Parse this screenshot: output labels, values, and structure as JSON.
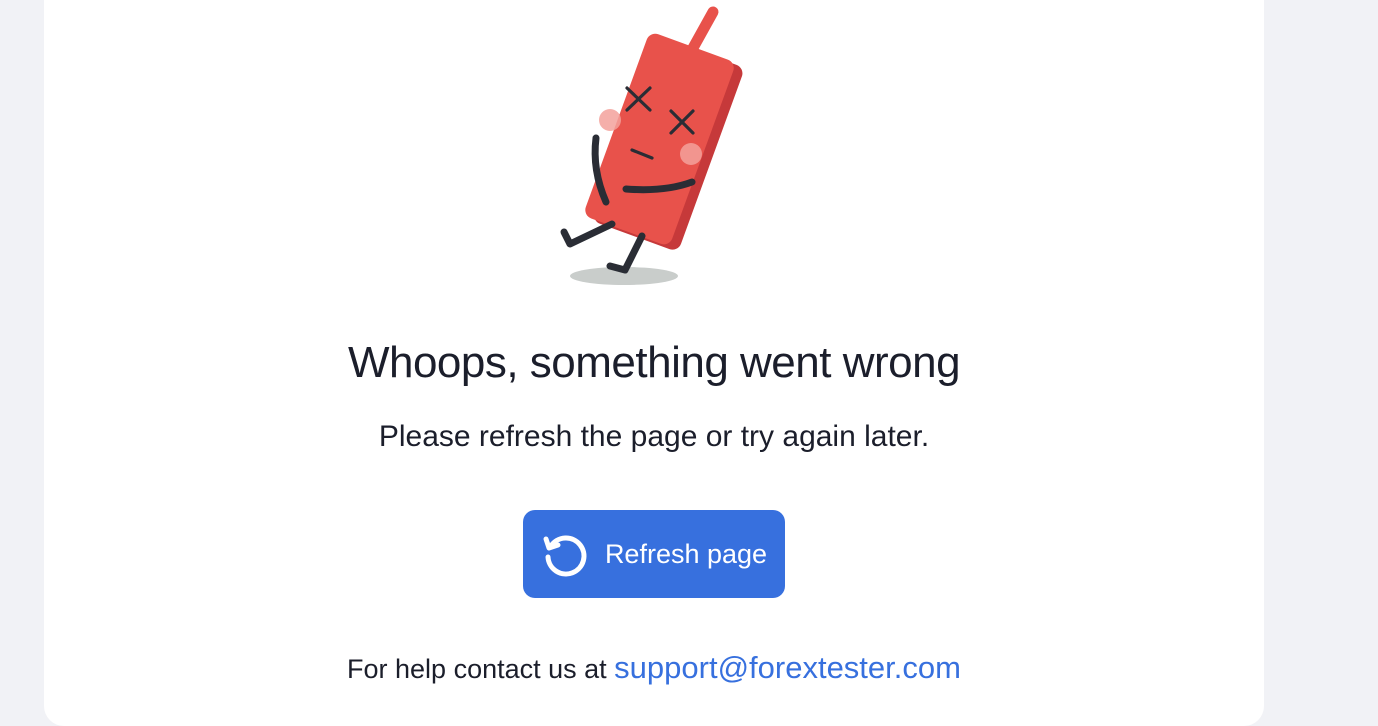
{
  "error": {
    "title": "Whoops, something went wrong",
    "message": "Please refresh the page or try again later.",
    "refresh_button_label": "Refresh page",
    "help_prefix": "For help contact us at",
    "support_email": "support@forextester.com"
  },
  "icons": {
    "refresh": "refresh-icon",
    "mascot": "broken-phone-mascot"
  },
  "colors": {
    "accent": "#3770de",
    "mascot_red": "#e8524b",
    "text": "#1b1e2b",
    "background": "#f1f2f6"
  }
}
